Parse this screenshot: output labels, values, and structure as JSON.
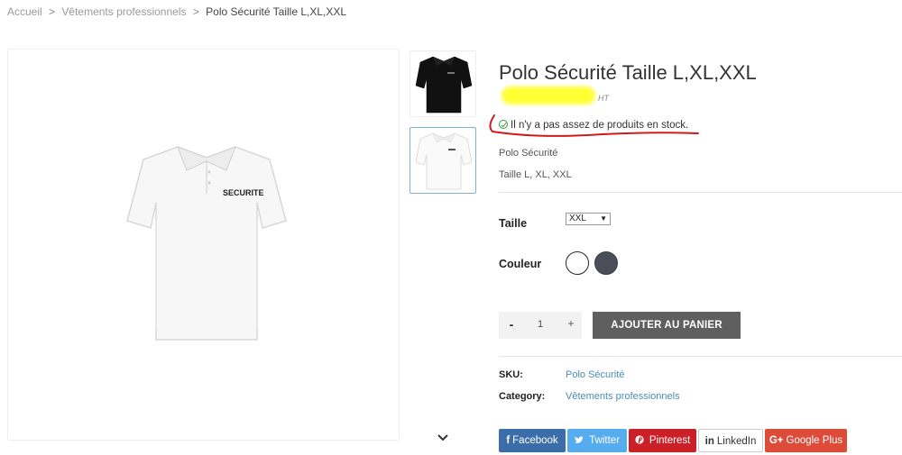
{
  "breadcrumb": {
    "home": "Accueil",
    "category": "Vêtements professionnels",
    "current": "Polo Sécurité Taille L,XL,XXL",
    "sep1": ">",
    "sep2": ">"
  },
  "product": {
    "title": "Polo Sécurité Taille L,XL,XXL",
    "price_suffix": "HT",
    "stock_message": "Il n'y a pas assez de produits en stock.",
    "description_line1": "Polo Sécurité",
    "description_line2": "Taille L, XL, XXL",
    "image_text": "SECURITE"
  },
  "options": {
    "size_label": "Taille",
    "size_value": "XXL",
    "color_label": "Couleur",
    "colors": [
      "#ffffff",
      "#4a4f57"
    ]
  },
  "cart": {
    "minus": "-",
    "quantity": "1",
    "plus": "+",
    "add_label": "AJOUTER AU PANIER"
  },
  "meta": {
    "sku_label": "SKU:",
    "sku_value": "Polo Sécurité",
    "category_label": "Category:",
    "category_value": "Vêtements professionnels"
  },
  "share": {
    "facebook": "Facebook",
    "twitter": "Twitter",
    "pinterest": "Pinterest",
    "linkedin": "LinkedIn",
    "googleplus": "Google Plus",
    "googleplus_icon": "G+"
  },
  "colors": {
    "accent_link": "#4a8db8",
    "stock_annotation": "#d11a1a",
    "price_highlight": "#ffff33"
  }
}
